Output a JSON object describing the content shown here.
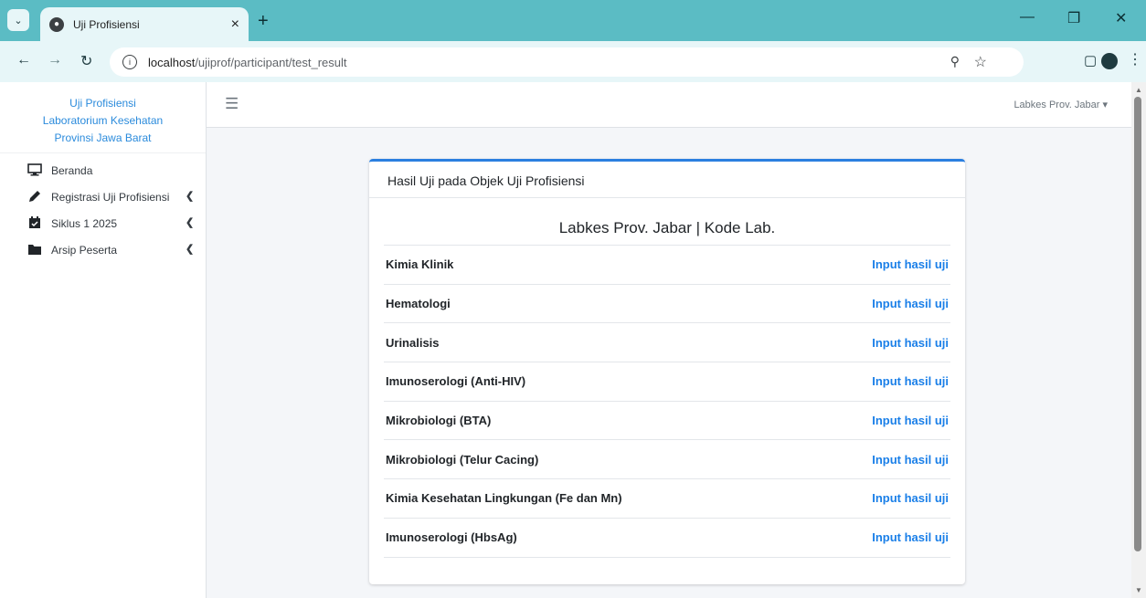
{
  "browser": {
    "tab_title": "Uji Profisiensi",
    "url_host": "localhost",
    "url_path": "/ujiprof/participant/test_result"
  },
  "sidebar": {
    "brand_lines": [
      "Uji Profisiensi",
      "Laboratorium Kesehatan",
      "Provinsi Jawa Barat"
    ],
    "items": [
      {
        "label": "Beranda",
        "icon": "desktop-icon",
        "has_chevron": false
      },
      {
        "label": "Registrasi Uji Profisiensi",
        "icon": "pencil-icon",
        "has_chevron": true
      },
      {
        "label": "Siklus 1 2025",
        "icon": "calendar-check-icon",
        "has_chevron": true
      },
      {
        "label": "Arsip Peserta",
        "icon": "folder-icon",
        "has_chevron": true
      }
    ]
  },
  "topnav": {
    "user_label": "Labkes Prov. Jabar"
  },
  "card": {
    "header": "Hasil Uji pada Objek Uji Profisiensi",
    "lab_title": "Labkes Prov. Jabar | Kode Lab.",
    "rows": [
      {
        "name": "Kimia Klinik",
        "link": "Input hasil uji"
      },
      {
        "name": "Hematologi",
        "link": "Input hasil uji"
      },
      {
        "name": "Urinalisis",
        "link": "Input hasil uji"
      },
      {
        "name": "Imunoserologi (Anti-HIV)",
        "link": "Input hasil uji"
      },
      {
        "name": "Mikrobiologi (BTA)",
        "link": "Input hasil uji"
      },
      {
        "name": "Mikrobiologi (Telur Cacing)",
        "link": "Input hasil uji"
      },
      {
        "name": "Kimia Kesehatan Lingkungan (Fe dan Mn)",
        "link": "Input hasil uji"
      },
      {
        "name": "Imunoserologi (HbsAg)",
        "link": "Input hasil uji"
      }
    ]
  },
  "colors": {
    "accent": "#2b7fe0",
    "link": "#1a7fe8",
    "brand_text": "#2b8bdc",
    "tab_bar": "#5bbcc4"
  }
}
